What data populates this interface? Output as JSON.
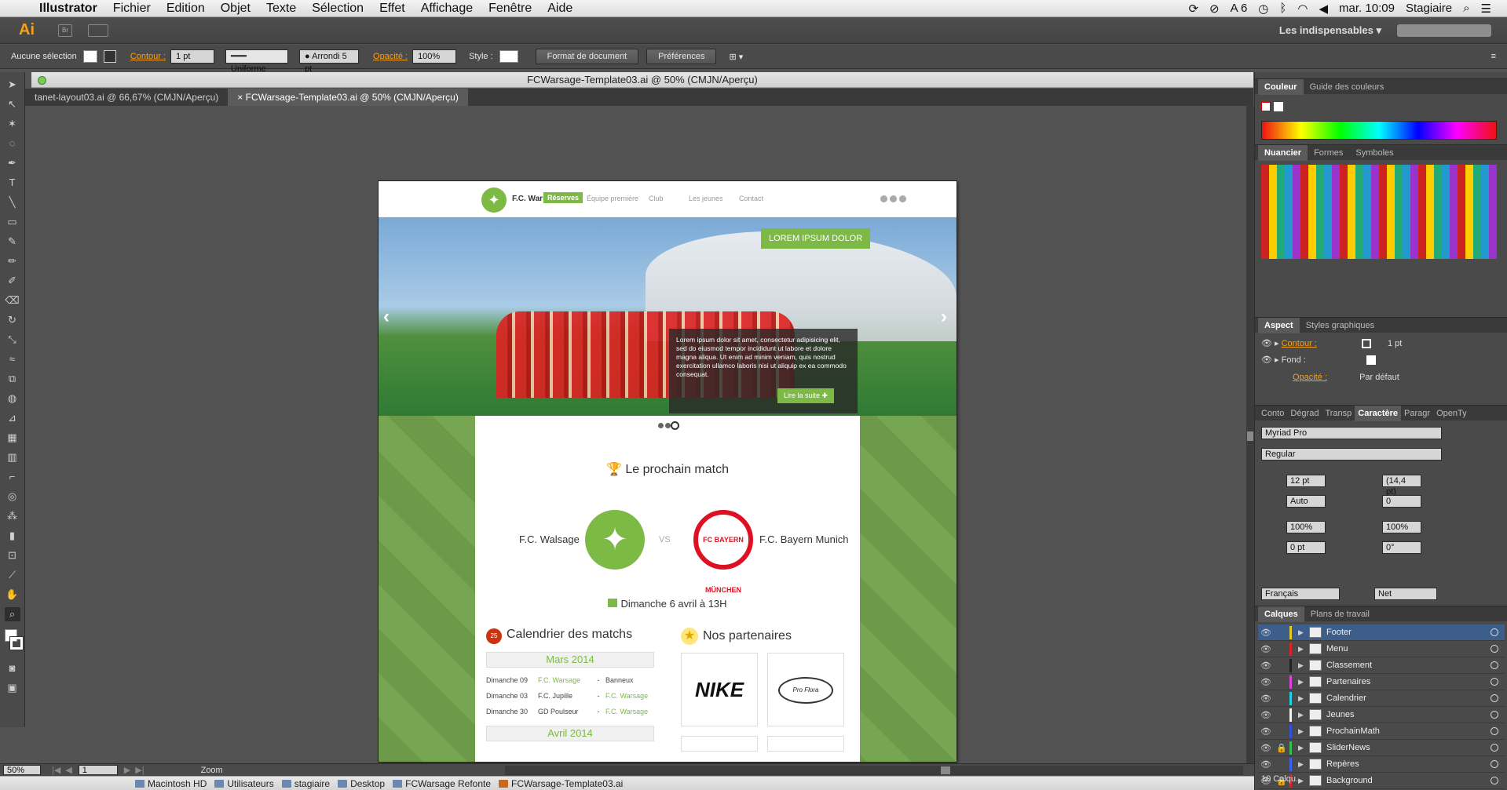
{
  "menubar": {
    "app": "Illustrator",
    "items": [
      "Fichier",
      "Edition",
      "Objet",
      "Texte",
      "Sélection",
      "Effet",
      "Affichage",
      "Fenêtre",
      "Aide"
    ],
    "status_6": "6",
    "clock": "mar. 10:09",
    "user": "Stagiaire"
  },
  "appbar": {
    "logo": "Ai",
    "bridge": "Br",
    "workspace": "Les indispensables"
  },
  "control": {
    "selection": "Aucune sélection",
    "stroke_label": "Contour :",
    "stroke_value": "1 pt",
    "profile": "Uniforme",
    "brush": "Arrondi 5 pt",
    "opacity_label": "Opacité :",
    "opacity_value": "100%",
    "style_label": "Style :",
    "doc_format": "Format de document",
    "prefs": "Préférences"
  },
  "document": {
    "title": "FCWarsage-Template03.ai @ 50% (CMJN/Aperçu)",
    "tabs": [
      "tanet-layout03.ai @ 66,67% (CMJN/Aperçu)",
      "FCWarsage-Template03.ai @ 50% (CMJN/Aperçu)"
    ]
  },
  "site": {
    "club": "F.C. Warsage",
    "nav": [
      "Réserves",
      "Équipe première",
      "Club",
      "Les jeunes",
      "Contact"
    ],
    "slide_tag": "LOREM IPSUM DOLOR",
    "slide_text": "Lorem ipsum dolor sit amet, consectetur adipisicing elit, sed do eiusmod tempor incididunt ut labore et dolore magna aliqua. Ut enim ad minim veniam, quis nostrud exercitation ullamco laboris nisi ut aliquip ex ea commodo consequat.",
    "read_more": "Lire la suite",
    "next_match": "Le prochain match",
    "home_team": "F.C. Walsage",
    "vs": "VS",
    "away_team": "F.C. Bayern Munich",
    "away_logo_text": "FC BAYERN MÜNCHEN",
    "match_date": "Dimanche 6 avril à 13H",
    "calendar_title": "Calendrier des matchs",
    "calendar_badge": "25",
    "month1": "Mars 2014",
    "month2": "Avril 2014",
    "fixtures": [
      {
        "date": "Dimanche 09",
        "home": "F.C. Warsage",
        "sep": "-",
        "away": "Banneux"
      },
      {
        "date": "Dimanche 03",
        "home": "F.C. Jupille",
        "sep": "-",
        "away": "F.C. Warsage"
      },
      {
        "date": "Dimanche 30",
        "home": "GD Poulseur",
        "sep": "-",
        "away": "F.C. Warsage"
      }
    ],
    "partners_title": "Nos partenaires",
    "partner1": "NIKE",
    "partner2": "Pro Flora"
  },
  "panels": {
    "color_tabs": [
      "Couleur",
      "Guide des couleurs"
    ],
    "swatch_tabs": [
      "Nuancier",
      "Formes",
      "Symboles"
    ],
    "aspect_tabs": [
      "Aspect",
      "Styles graphiques"
    ],
    "aspect_stroke": "Contour :",
    "aspect_stroke_val": "1 pt",
    "aspect_fill": "Fond :",
    "aspect_opacity": "Opacité :",
    "aspect_opacity_val": "Par défaut",
    "type_tabs": [
      "Conto",
      "Dégrad",
      "Transp",
      "Caractère",
      "Paragr",
      "OpenTy"
    ],
    "font": "Myriad Pro",
    "font_style": "Regular",
    "size": "12 pt",
    "leading": "(14,4 pt)",
    "kerning": "Auto",
    "tracking": "0",
    "vscale": "100%",
    "hscale": "100%",
    "baseline": "0 pt",
    "rotation": "0°",
    "language": "Français",
    "aa": "Net",
    "layer_tabs": [
      "Calques",
      "Plans de travail"
    ],
    "layers": [
      {
        "name": "Footer",
        "color": "#e8c820",
        "locked": false
      },
      {
        "name": "Menu",
        "color": "#e02020",
        "locked": false
      },
      {
        "name": "Classement",
        "color": "#222222",
        "locked": false
      },
      {
        "name": "Partenaires",
        "color": "#e040e0",
        "locked": false
      },
      {
        "name": "Calendrier",
        "color": "#20d0e0",
        "locked": false
      },
      {
        "name": "Jeunes",
        "color": "#f0f0f0",
        "locked": false
      },
      {
        "name": "ProchainMath",
        "color": "#3050e0",
        "locked": false
      },
      {
        "name": "SliderNews",
        "color": "#30c050",
        "locked": true
      },
      {
        "name": "Repères",
        "color": "#4060f0",
        "locked": false
      },
      {
        "name": "Background",
        "color": "#e02020",
        "locked": true
      }
    ],
    "layer_count": "10 Calqu..."
  },
  "status": {
    "zoom": "50%",
    "page": "1",
    "tool": "Zoom"
  },
  "path": [
    "Macintosh HD",
    "Utilisateurs",
    "stagiaire",
    "Desktop",
    "FCWarsage Refonte",
    "FCWarsage-Template03.ai"
  ]
}
